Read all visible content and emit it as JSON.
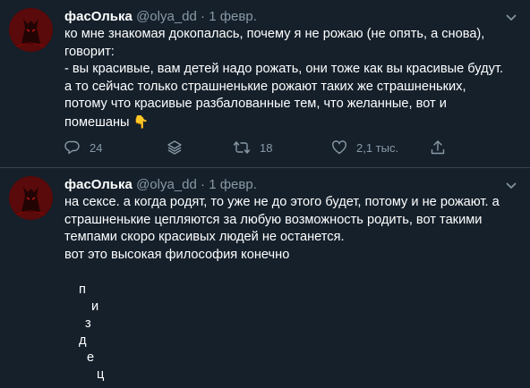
{
  "tweets": [
    {
      "author_name": "фасОлька",
      "handle": "@olya_dd",
      "separator": "·",
      "date": "1 февр.",
      "lines": [
        "ко мне знакомая докопалась, почему я не рожаю (не опять, а снова),",
        "говорит:",
        "- вы красивые, вам детей надо рожать, они тоже как вы красивые будут.",
        "а то сейчас только страшненькие рожают таких же страшненьких,",
        "потому что красивые разбалованные тем, что желанные, вот и",
        "помешаны"
      ],
      "emoji": "👇",
      "replies": "24",
      "retweets": "18",
      "likes": "2,1 тыс."
    },
    {
      "author_name": "фасОлька",
      "handle": "@olya_dd",
      "separator": "·",
      "date": "1 февр.",
      "lines": [
        "на сексе. а когда родят, то уже не до этого будет, потому и не рожают. а",
        "страшненькие цепляются за любую возможность родить, вот такими",
        "темпами скоро красивых людей не останется.",
        "",
        "вот это высокая философия конечно"
      ],
      "vertical_letters": [
        "п",
        "и",
        "з",
        "д",
        "е",
        "ц"
      ]
    }
  ],
  "icons": {
    "more": "chevron-down-icon",
    "reply": "reply-icon",
    "stack": "stack-icon",
    "retweet": "retweet-icon",
    "like": "heart-icon",
    "share": "share-icon"
  },
  "colors": {
    "background": "#15202b",
    "secondary_text": "#8899a6",
    "divider": "#38444d"
  }
}
